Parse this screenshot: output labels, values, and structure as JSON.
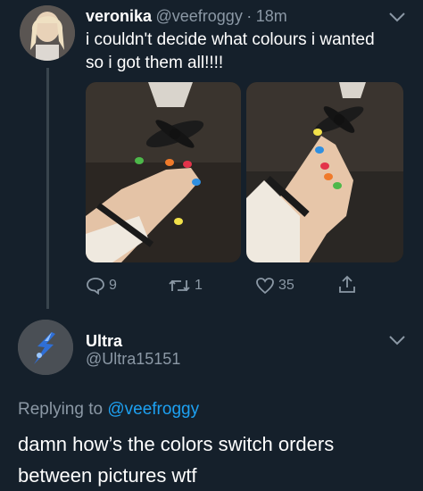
{
  "tweet": {
    "display_name": "veronika",
    "handle": "@veefroggy",
    "separator": "·",
    "time": "18m",
    "text_line1": "i couldn't decide what colours i wanted",
    "text_line2": "so i got them all!!!!",
    "replies": "9",
    "retweets": "1",
    "likes": "35"
  },
  "reply": {
    "display_name": "Ultra",
    "handle": "@Ultra15151",
    "replying_prefix": "Replying to",
    "replying_handle": "@veefroggy",
    "text_line1": "damn how’s the colors switch orders",
    "text_line2": "between pictures wtf"
  },
  "icons": {
    "reply": "speech-bubble-icon",
    "retweet": "retweet-icon",
    "like": "heart-icon",
    "share": "share-icon",
    "more": "chevron-down-icon"
  },
  "colors": {
    "background": "#15202b",
    "text": "#ffffff",
    "muted": "#8b98a5",
    "link": "#1da1f2"
  }
}
